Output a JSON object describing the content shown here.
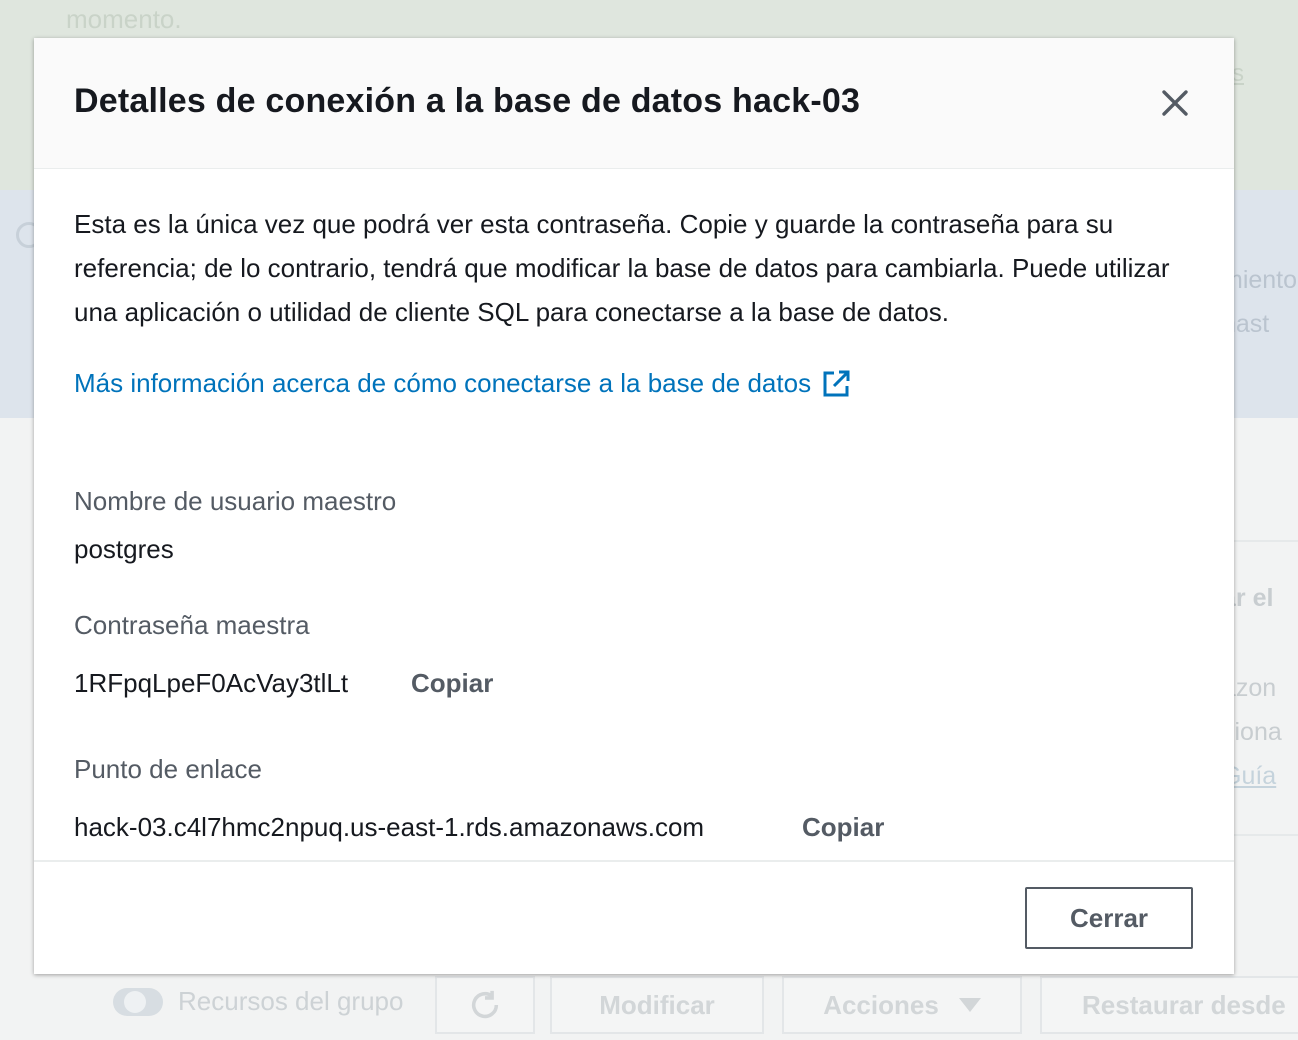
{
  "background": {
    "success_text": "momento.",
    "success_link": "s",
    "info_lines": [
      "miento",
      "hast"
    ],
    "panel_lines": [
      "ar el",
      "azon",
      "ciona",
      "Guía"
    ],
    "toolbar": {
      "group_resources_label": "Recursos del grupo",
      "modify_label": "Modificar",
      "actions_label": "Acciones",
      "restore_label": "Restaurar desde"
    }
  },
  "modal": {
    "title": "Detalles de conexión a la base de datos hack-03",
    "intro": "Esta es la única vez que podrá ver esta contraseña. Copie y guarde la contraseña para su referencia; de lo contrario, tendrá que modificar la base de datos para cambiarla. Puede utilizar una aplicación o utilidad de cliente SQL para conectarse a la base de datos.",
    "learn_more_link": "Más información acerca de cómo conectarse a la base de datos",
    "fields": {
      "username": {
        "label": "Nombre de usuario maestro",
        "value": "postgres"
      },
      "password": {
        "label": "Contraseña maestra",
        "value": "1RFpqLpeF0AcVay3tlLt",
        "copy_label": "Copiar"
      },
      "endpoint": {
        "label": "Punto de enlace",
        "value": "hack-03.c4l7hmc2npuq.us-east-1.rds.amazonaws.com",
        "copy_label": "Copiar"
      }
    },
    "close_button_label": "Cerrar"
  },
  "colors": {
    "link": "#0073bb",
    "text": "#16191f",
    "muted": "#545b64"
  },
  "icons": [
    "close-icon",
    "external-link-icon",
    "refresh-icon",
    "caret-down-icon",
    "info-icon"
  ]
}
